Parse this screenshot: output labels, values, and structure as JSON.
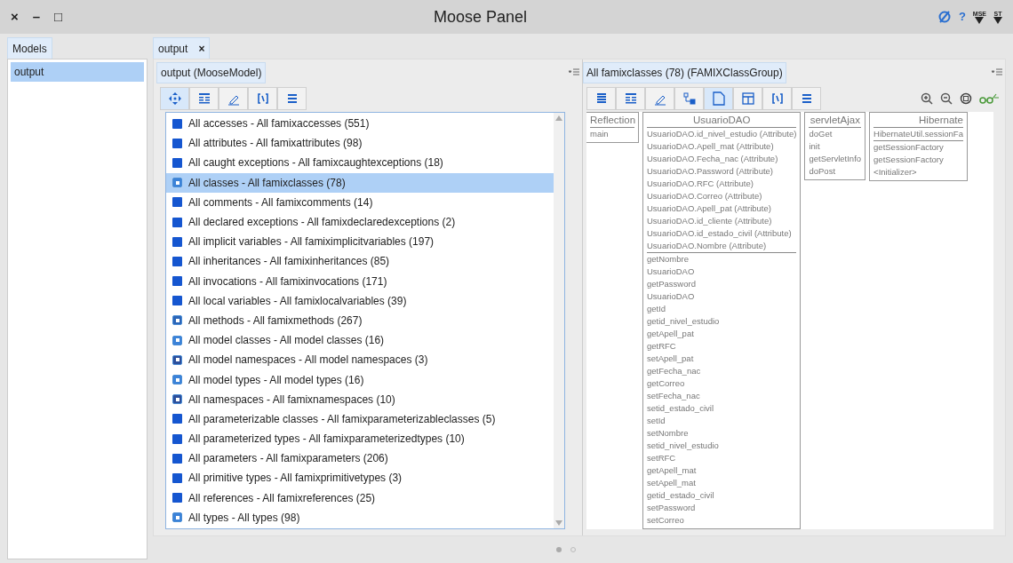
{
  "window": {
    "title": "Moose Panel",
    "controls": [
      "×",
      "–",
      "□"
    ],
    "help": "?",
    "tools": [
      "MSE",
      "ST"
    ]
  },
  "models_panel": {
    "tab": {
      "label": "Models",
      "selected": true
    },
    "items": [
      {
        "label": "output",
        "selected": true
      }
    ]
  },
  "tabs": [
    {
      "label": "output",
      "selected": true,
      "close": "×"
    }
  ],
  "left_pane": {
    "header": "output (MooseModel)",
    "toolbar": [
      {
        "kind": "move",
        "selected": true
      },
      {
        "kind": "table",
        "selected": false
      },
      {
        "kind": "pencil",
        "selected": false
      },
      {
        "kind": "brackets",
        "selected": false
      },
      {
        "kind": "lines",
        "selected": false
      }
    ],
    "items": [
      {
        "label": "All accesses - All famixaccesses (551)",
        "kind": "group",
        "selected": false
      },
      {
        "label": "All attributes - All famixattributes (98)",
        "kind": "group",
        "selected": false
      },
      {
        "label": "All caught exceptions - All famixcaughtexceptions (18)",
        "kind": "group",
        "selected": false
      },
      {
        "label": "All classes - All famixclasses (78)",
        "kind": "class",
        "selected": true
      },
      {
        "label": "All comments - All famixcomments (14)",
        "kind": "group",
        "selected": false
      },
      {
        "label": "All declared exceptions - All famixdeclaredexceptions (2)",
        "kind": "group",
        "selected": false
      },
      {
        "label": "All implicit variables - All famiximplicitvariables (197)",
        "kind": "group",
        "selected": false
      },
      {
        "label": "All inheritances - All famixinheritances (85)",
        "kind": "group",
        "selected": false
      },
      {
        "label": "All invocations - All famixinvocations (171)",
        "kind": "group",
        "selected": false
      },
      {
        "label": "All local variables - All famixlocalvariables (39)",
        "kind": "group",
        "selected": false
      },
      {
        "label": "All methods - All famixmethods (267)",
        "kind": "method",
        "selected": false
      },
      {
        "label": "All model classes - All model classes (16)",
        "kind": "class",
        "selected": false
      },
      {
        "label": "All model namespaces - All model namespaces (3)",
        "kind": "namespace",
        "selected": false
      },
      {
        "label": "All model types - All model types (16)",
        "kind": "class",
        "selected": false
      },
      {
        "label": "All namespaces - All famixnamespaces (10)",
        "kind": "namespace",
        "selected": false
      },
      {
        "label": "All parameterizable classes - All famixparameterizableclasses (5)",
        "kind": "group",
        "selected": false
      },
      {
        "label": "All parameterized types - All famixparameterizedtypes (10)",
        "kind": "group",
        "selected": false
      },
      {
        "label": "All parameters - All famixparameters (206)",
        "kind": "group",
        "selected": false
      },
      {
        "label": "All primitive types - All famixprimitivetypes (3)",
        "kind": "group",
        "selected": false
      },
      {
        "label": "All references - All famixreferences (25)",
        "kind": "group",
        "selected": false
      },
      {
        "label": "All types - All types (98)",
        "kind": "class",
        "selected": false
      }
    ]
  },
  "right_pane": {
    "header": "All famixclasses (78) (FAMIXClassGroup)",
    "toolbar": [
      {
        "kind": "list",
        "selected": false
      },
      {
        "kind": "table",
        "selected": false
      },
      {
        "kind": "pencil",
        "selected": false
      },
      {
        "kind": "tree",
        "selected": false
      },
      {
        "kind": "page",
        "selected": true
      },
      {
        "kind": "window",
        "selected": false
      },
      {
        "kind": "brackets",
        "selected": false
      },
      {
        "kind": "lines",
        "selected": false
      }
    ],
    "classes": [
      {
        "name": "Reflection",
        "methods": [
          "main"
        ]
      },
      {
        "name": "UsuarioDAO",
        "attributes": [
          "UsuarioDAO.id_nivel_estudio (Attribute)",
          "UsuarioDAO.Apell_mat (Attribute)",
          "UsuarioDAO.Fecha_nac (Attribute)",
          "UsuarioDAO.Password (Attribute)",
          "UsuarioDAO.RFC (Attribute)",
          "UsuarioDAO.Correo (Attribute)",
          "UsuarioDAO.Apell_pat (Attribute)",
          "UsuarioDAO.id_cliente (Attribute)",
          "UsuarioDAO.id_estado_civil (Attribute)",
          "UsuarioDAO.Nombre (Attribute)"
        ],
        "methods": [
          "getNombre",
          "UsuarioDAO",
          "getPassword",
          "UsuarioDAO",
          "getId",
          "getid_nivel_estudio",
          "getApell_pat",
          "getRFC",
          "setApell_pat",
          "getFecha_nac",
          "getCorreo",
          "setFecha_nac",
          "setid_estado_civil",
          "setId",
          "setNombre",
          "setid_nivel_estudio",
          "setRFC",
          "getApell_mat",
          "setApell_mat",
          "getid_estado_civil",
          "setPassword",
          "setCorreo"
        ]
      },
      {
        "name": "servletAjax",
        "methods": [
          "doGet",
          "init",
          "getServletInfo",
          "doPost"
        ]
      },
      {
        "name": "Hibernate",
        "attributes": [
          "HibernateUtil.sessionFa"
        ],
        "methods": [
          "getSessionFactory",
          "getSessionFactory",
          "<Initializer>"
        ]
      }
    ]
  },
  "pager": [
    {
      "selected": true
    },
    {
      "selected": false
    }
  ]
}
